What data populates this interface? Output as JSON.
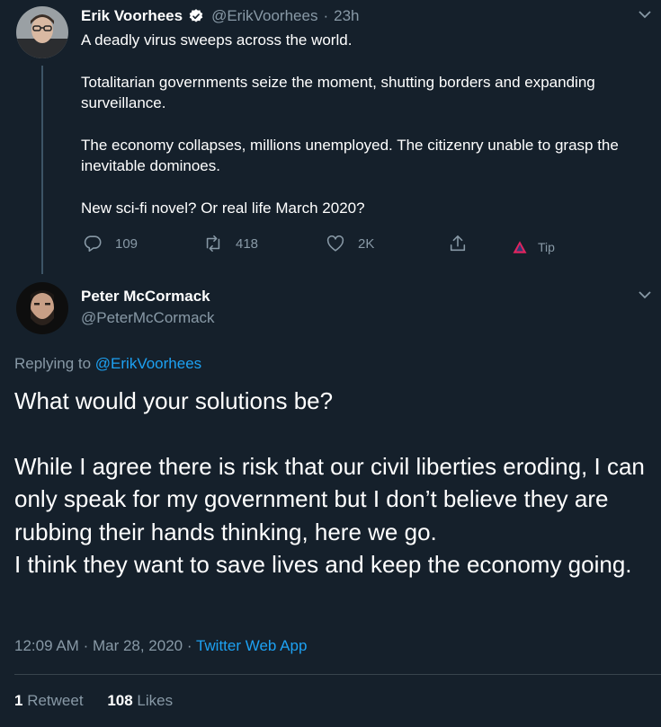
{
  "parent_tweet": {
    "display_name": "Erik Voorhees",
    "handle": "@ErikVoorhees",
    "separator": "·",
    "time": "23h",
    "paragraphs": [
      "A deadly virus sweeps across the world.",
      "Totalitarian governments seize the moment, shutting borders and expanding surveillance.",
      "The economy collapses, millions unemployed. The citizenry unable to grasp the inevitable dominoes.",
      "New sci-fi novel? Or real life March 2020?"
    ],
    "actions": {
      "reply_count": "109",
      "retweet_count": "418",
      "like_count": "2K",
      "tip_label": "Tip"
    }
  },
  "main_tweet": {
    "display_name": "Peter McCormack",
    "handle": "@PeterMcCormack",
    "replying_prefix": "Replying to",
    "replying_to": "@ErikVoorhees",
    "paragraphs": [
      "What would your solutions be?",
      "While I agree there is risk that our civil liberties eroding, I can only speak for my government but I don’t believe they are rubbing their hands thinking, here we go.\nI think they want to save lives and keep the economy going."
    ],
    "time": "12:09 AM",
    "date": "Mar 28, 2020",
    "source": "Twitter Web App",
    "retweets_count": "1",
    "retweets_label": "Retweet",
    "likes_count": "108",
    "likes_label": "Likes"
  },
  "colors": {
    "background": "#15202b",
    "muted": "#8899a6",
    "link": "#1da1f2",
    "tip_accent": "#e0245e"
  },
  "icons": [
    "verified-badge-icon",
    "chevron-down-icon",
    "reply-icon",
    "retweet-icon",
    "like-icon",
    "share-icon",
    "tip-icon"
  ]
}
